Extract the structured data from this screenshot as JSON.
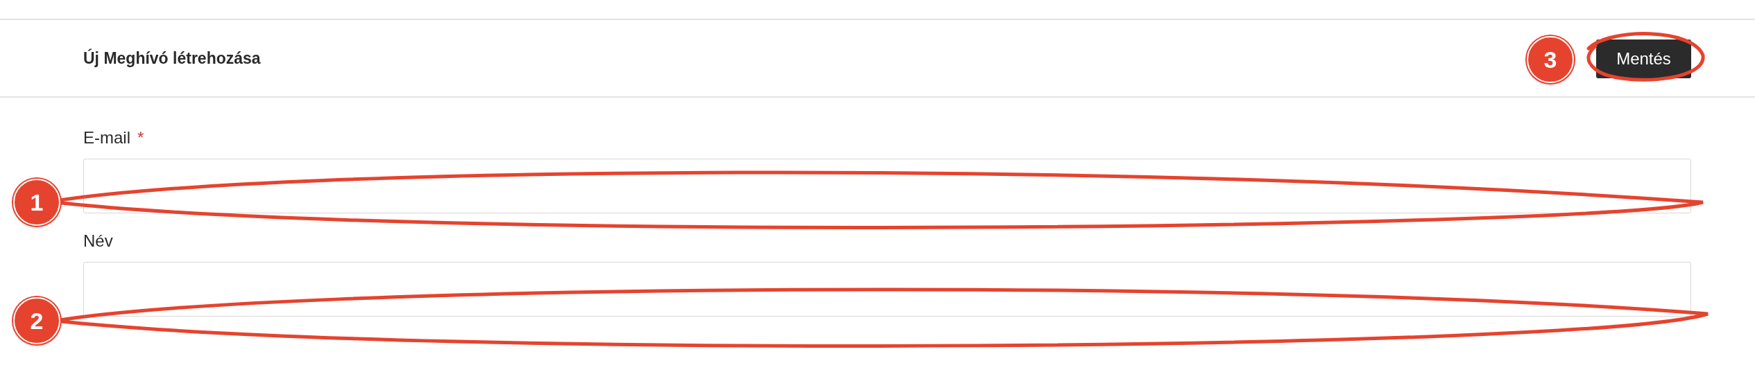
{
  "header": {
    "title": "Új Meghívó létrehozása",
    "save_button": "Mentés"
  },
  "fields": [
    {
      "label": "E-mail",
      "required_mark": "*"
    },
    {
      "label": "Név"
    }
  ],
  "annotations": [
    {
      "number": "1"
    },
    {
      "number": "2"
    },
    {
      "number": "3"
    }
  ]
}
